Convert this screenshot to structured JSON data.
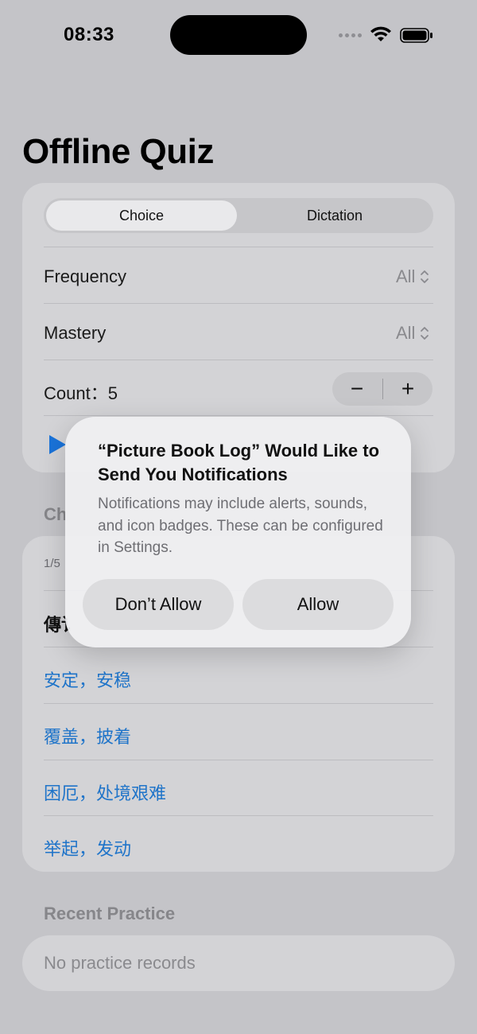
{
  "status_bar": {
    "time": "08:33"
  },
  "title": "Offline Quiz",
  "mode_tabs": [
    {
      "label": "Choice",
      "selected": true
    },
    {
      "label": "Dictation",
      "selected": false
    }
  ],
  "settings": {
    "frequency": {
      "label": "Frequency",
      "value": "All"
    },
    "mastery": {
      "label": "Mastery",
      "value": "All"
    },
    "count": {
      "label": "Count：",
      "value": "5",
      "decrement": "−",
      "increment": "+"
    }
  },
  "choice_section": {
    "header": "Ch",
    "progress": "1/5",
    "question": "傳讠",
    "options": [
      "安定，安稳",
      "覆盖，披着",
      "困厄，处境艰难",
      "举起，发动"
    ]
  },
  "recent": {
    "header": "Recent Practice",
    "empty_text": "No practice records"
  },
  "alert": {
    "title": "“Picture Book Log” Would Like to Send You Notifications",
    "message": "Notifications may include alerts, sounds, and icon badges. These can be configured in Settings.",
    "deny_label": "Don’t Allow",
    "allow_label": "Allow"
  },
  "colors": {
    "accent": "#1f74c9",
    "play": "#1a73d9"
  },
  "icons": [
    "wifi-icon",
    "battery-icon",
    "updown-chevron-icon",
    "play-icon"
  ]
}
